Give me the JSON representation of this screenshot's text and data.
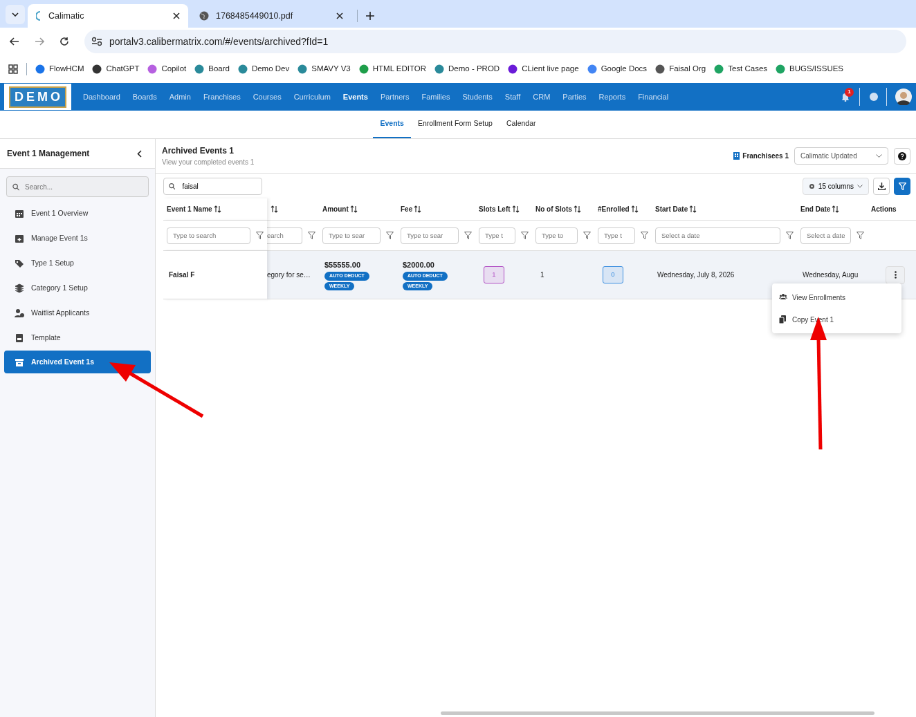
{
  "browser": {
    "tabs": [
      {
        "title": "Calimatic",
        "selected": true
      },
      {
        "title": "1768485449010.pdf",
        "selected": false
      }
    ],
    "address": "portalv3.calibermatrix.com/#/events/archived?fId=1",
    "bookmarks": [
      {
        "label": "FlowHCM",
        "color": "#1a73e8"
      },
      {
        "label": "ChatGPT",
        "color": "#333333"
      },
      {
        "label": "Copilot",
        "color": "#b660e0"
      },
      {
        "label": "Board",
        "color": "#2a8a9a"
      },
      {
        "label": "Demo Dev",
        "color": "#2a8a9a"
      },
      {
        "label": "SMAVY V3",
        "color": "#2a8a9a"
      },
      {
        "label": "HTML EDITOR",
        "color": "#1e9e4a"
      },
      {
        "label": "Demo - PROD",
        "color": "#2a8a9a"
      },
      {
        "label": "CLient live page",
        "color": "#6a1bd8"
      },
      {
        "label": "Google Docs",
        "color": "#4285f4"
      },
      {
        "label": "Faisal Org",
        "color": "#555555"
      },
      {
        "label": "Test Cases",
        "color": "#1fa463"
      },
      {
        "label": "BUGS/ISSUES",
        "color": "#1fa463"
      }
    ]
  },
  "app": {
    "logo": "DEMO",
    "nav": [
      {
        "label": "Dashboard",
        "selected": false
      },
      {
        "label": "Boards",
        "selected": false
      },
      {
        "label": "Admin",
        "selected": false
      },
      {
        "label": "Franchises",
        "selected": false
      },
      {
        "label": "Courses",
        "selected": false
      },
      {
        "label": "Curriculum",
        "selected": false
      },
      {
        "label": "Events",
        "selected": true
      },
      {
        "label": "Partners",
        "selected": false
      },
      {
        "label": "Families",
        "selected": false
      },
      {
        "label": "Students",
        "selected": false
      },
      {
        "label": "Staff",
        "selected": false
      },
      {
        "label": "CRM",
        "selected": false
      },
      {
        "label": "Parties",
        "selected": false
      },
      {
        "label": "Reports",
        "selected": false
      },
      {
        "label": "Financial",
        "selected": false
      }
    ],
    "notification_count": "1"
  },
  "subtabs": [
    {
      "label": "Events",
      "selected": true
    },
    {
      "label": "Enrollment Form Setup",
      "selected": false
    },
    {
      "label": "Calendar",
      "selected": false
    }
  ],
  "sidebar": {
    "title": "Event 1 Management",
    "search_placeholder": "Search...",
    "items": [
      {
        "label": "Event 1 Overview",
        "selected": false
      },
      {
        "label": "Manage Event 1s",
        "selected": false
      },
      {
        "label": "Type 1 Setup",
        "selected": false
      },
      {
        "label": "Category 1 Setup",
        "selected": false
      },
      {
        "label": "Waitlist Applicants",
        "selected": false
      },
      {
        "label": "Template",
        "selected": false
      },
      {
        "label": "Archived Event 1s",
        "selected": true
      }
    ]
  },
  "page": {
    "title": "Archived Events 1",
    "subtitle": "View your completed events 1",
    "franchisee_label": "Franchisees 1",
    "franchisee_select": "Calimatic Updated",
    "search_value": "faisal",
    "columns_button": "15 columns"
  },
  "table": {
    "columns": [
      {
        "label": "Event 1 Name",
        "sortable": true,
        "placeholder": "Type to search"
      },
      {
        "sortable": true,
        "placeholder": "earch"
      },
      {
        "label": "Amount",
        "sortable": true,
        "placeholder": "Type to sear"
      },
      {
        "label": "Fee",
        "sortable": true,
        "placeholder": "Type to sear"
      },
      {
        "label": "Slots Left",
        "sortable": true,
        "placeholder": "Type t"
      },
      {
        "label": "No of Slots",
        "sortable": true,
        "placeholder": "Type to"
      },
      {
        "label": "#Enrolled",
        "sortable": true,
        "placeholder": "Type t"
      },
      {
        "label": "Start Date",
        "sortable": true,
        "placeholder": "Select a date"
      },
      {
        "label": "End Date",
        "sortable": true,
        "placeholder": "Select a date"
      },
      {
        "label": "Actions",
        "sortable": false
      }
    ],
    "rows": [
      {
        "cells": [
          {
            "kind": "name",
            "text": "Faisal F"
          },
          {
            "kind": "text",
            "text": "egory for se…"
          },
          {
            "kind": "money",
            "text": "$55555.00",
            "tags": [
              "AUTO DEDUCT",
              "WEEKLY"
            ]
          },
          {
            "kind": "money",
            "text": "$2000.00",
            "tags": [
              "AUTO DEDUCT",
              "WEEKLY"
            ]
          },
          {
            "kind": "badge",
            "text": "1",
            "color": "#b14fc4"
          },
          {
            "kind": "text",
            "text": "1"
          },
          {
            "kind": "badge",
            "text": "0",
            "color": "#3d8fe0"
          },
          {
            "kind": "text",
            "text": "Wednesday, July 8, 2026"
          },
          {
            "kind": "text",
            "text": "Wednesday, Augu"
          },
          {
            "kind": "actions"
          }
        ]
      }
    ]
  },
  "action_menu": [
    {
      "label": "View Enrollments"
    },
    {
      "label": "Copy Event 1"
    }
  ]
}
